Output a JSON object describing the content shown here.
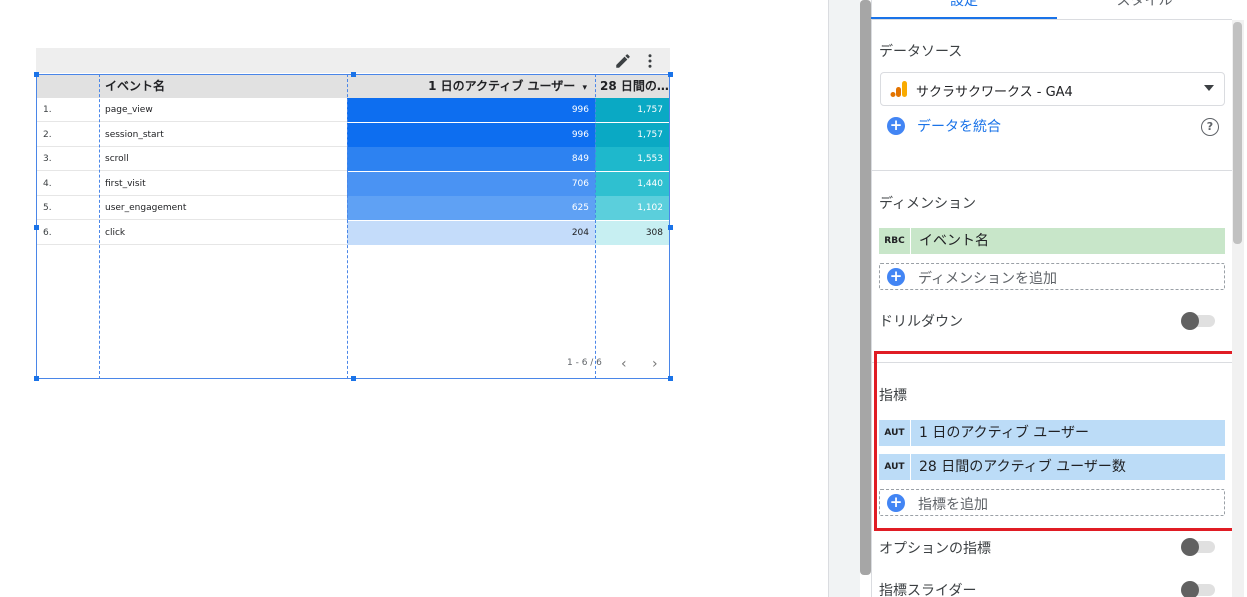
{
  "canvas": {
    "table": {
      "headers": {
        "dimension": "イベント名",
        "metric1": "1 日のアクティブ ユーザー",
        "metric1_sort": "▾",
        "metric2": "28 日間の…"
      },
      "rows": [
        {
          "idx": "1.",
          "name": "page_view",
          "v1": "996",
          "v2": "1,757",
          "v1_bg": "#0d6ef0",
          "v2_bg": "#0aa9c4"
        },
        {
          "idx": "2.",
          "name": "session_start",
          "v1": "996",
          "v2": "1,757",
          "v1_bg": "#0d6ef0",
          "v2_bg": "#0aa9c4"
        },
        {
          "idx": "3.",
          "name": "scroll",
          "v1": "849",
          "v2": "1,553",
          "v1_bg": "#2d82f1",
          "v2_bg": "#1eb8cc"
        },
        {
          "idx": "4.",
          "name": "first_visit",
          "v1": "706",
          "v2": "1,440",
          "v1_bg": "#4a93f3",
          "v2_bg": "#2fc0d0"
        },
        {
          "idx": "5.",
          "name": "user_engagement",
          "v1": "625",
          "v2": "1,102",
          "v1_bg": "#5fa1f4",
          "v2_bg": "#5bcfdc"
        },
        {
          "idx": "6.",
          "name": "click",
          "v1": "204",
          "v2": "308",
          "v1_bg": "#c4dcfa",
          "v2_bg": "#c7eff2"
        }
      ],
      "pager_text": "1 - 6 / 6",
      "prev": "‹",
      "next": "›"
    },
    "toolbar_icons": [
      "pencil-icon",
      "more-vert-icon"
    ]
  },
  "panel": {
    "tabs": {
      "setup": "設定",
      "style": "スタイル"
    },
    "data_source": {
      "label": "データソース",
      "selected": "サクラサクワークス - GA4",
      "blend_link": "データを統合",
      "help": "?"
    },
    "dimension": {
      "label": "ディメンション",
      "chip": {
        "tag": "RBC",
        "text": "イベント名"
      },
      "add": "ディメンションを追加"
    },
    "drilldown": {
      "label": "ドリルダウン"
    },
    "metrics": {
      "label": "指標",
      "chips": [
        {
          "tag": "AUT",
          "text": "1 日のアクティブ ユーザー"
        },
        {
          "tag": "AUT",
          "text": "28 日間のアクティブ ユーザー数"
        }
      ],
      "add": "指標を追加"
    },
    "optional_metrics": {
      "label": "オプションの指標"
    },
    "metric_slider": {
      "label": "指標スライダー"
    },
    "colors": {
      "accent": "#1a73e8",
      "highlight": "#e01c24",
      "ga_orange": "#f9ab00"
    }
  }
}
